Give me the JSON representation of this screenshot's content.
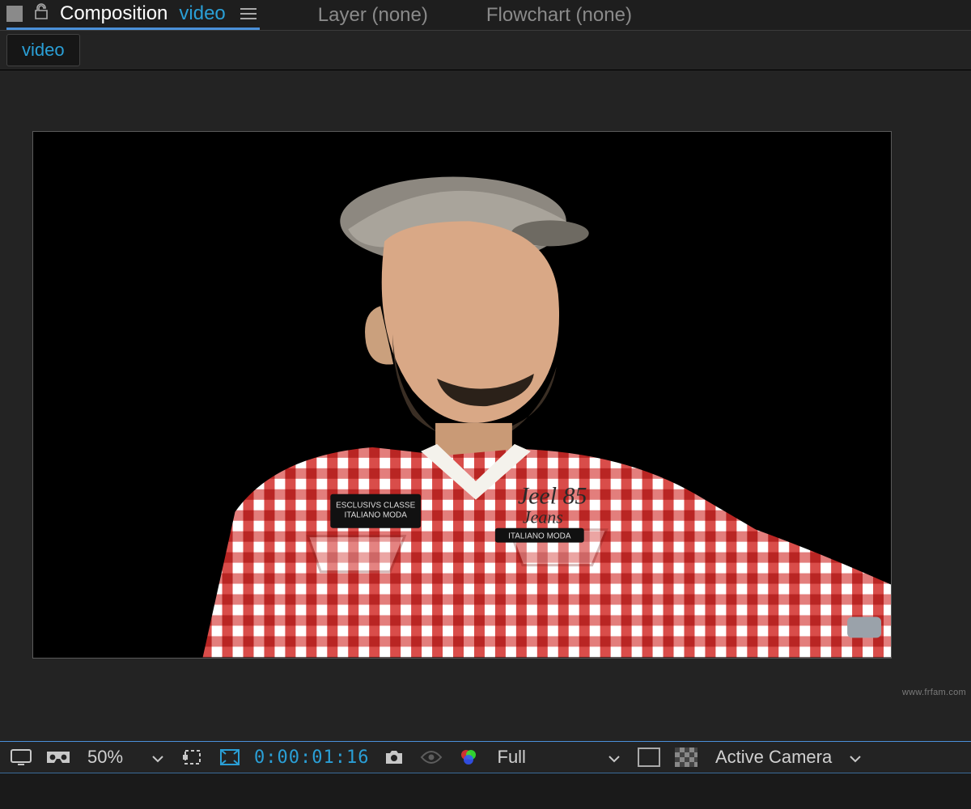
{
  "tabs": {
    "composition_label": "Composition",
    "composition_name": "video",
    "layer_label": "Layer (none)",
    "flowchart_label": "Flowchart (none)"
  },
  "sub_tabs": {
    "name": "video"
  },
  "controls": {
    "zoom": "50%",
    "timecode": "0:00:01:16",
    "resolution": "Full",
    "view": "Active Camera"
  },
  "icons": {
    "lock": "lock-icon",
    "menu": "menu-icon",
    "display": "display-icon",
    "vr": "vr-goggles-icon",
    "roi": "region-of-interest-icon",
    "title_safe": "title-action-safe-icon",
    "camera": "camera-icon",
    "eye": "preview-eye-icon",
    "channels": "channel-rgb-icon",
    "transparency_grid": "transparency-grid-icon",
    "mask_frame": "frame-outline-icon"
  },
  "watermark": "www.frfam.com"
}
